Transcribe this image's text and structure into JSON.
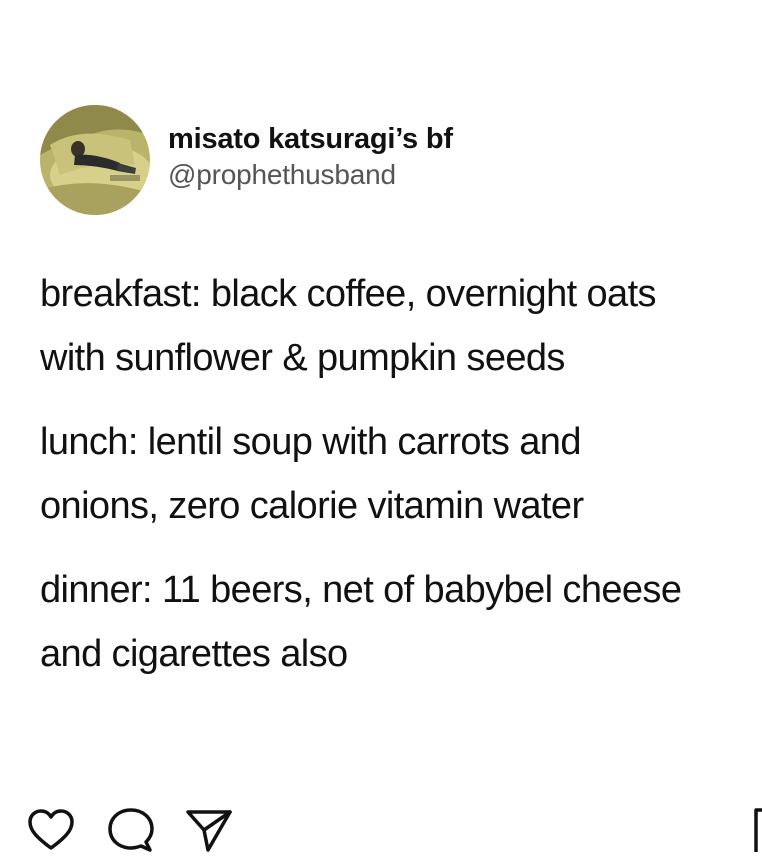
{
  "author": {
    "display_name": "misato katsuragi’s bf",
    "handle": "@prophethusband",
    "avatar_icon": "avatar-photo"
  },
  "post": {
    "lines": [
      "breakfast: black coffee, overnight oats",
      "with sunflower & pumpkin seeds",
      "lunch: lentil soup with carrots and",
      "onions, zero calorie vitamin water",
      "dinner: 11 beers, net of babybel cheese",
      "and cigarettes also"
    ]
  },
  "actions": {
    "like_icon": "heart-icon",
    "comment_icon": "speech-bubble-icon",
    "share_icon": "paper-plane-icon",
    "save_icon": "bookmark-icon"
  },
  "colors": {
    "text": "#111111",
    "handle": "#555555",
    "background": "#ffffff"
  }
}
